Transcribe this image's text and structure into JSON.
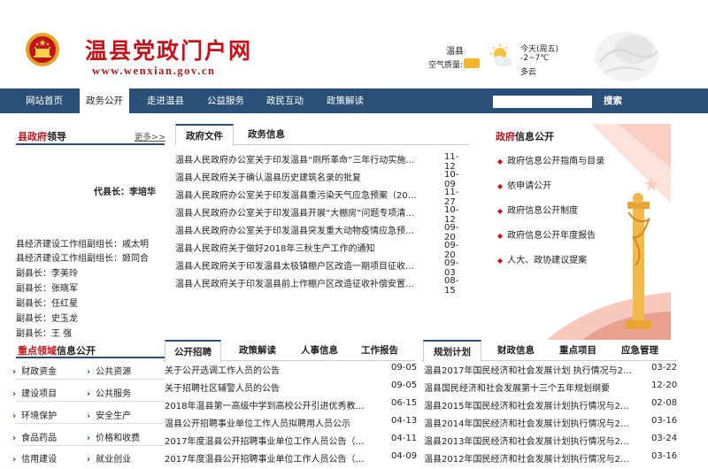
{
  "header": {
    "site_title": "温县党政门户网",
    "site_url": "www.wenxian.gov.cn",
    "weather": {
      "city": "温县",
      "air_quality_label": "空气质量:",
      "day": "今天(周五)",
      "temperature": "-2~7℃",
      "condition": "多云",
      "icon": "sun-cloud-icon"
    }
  },
  "nav": {
    "items": [
      "网站首页",
      "政务公开",
      "走进温县",
      "公益服务",
      "政民互动",
      "政策解读"
    ],
    "active_index": 1,
    "search_label": "搜索",
    "search_placeholder": ""
  },
  "leaders": {
    "title_red": "县政府",
    "title_rest": "领导",
    "more": "更多>>",
    "county_head": "代县长：李培华",
    "deputies": [
      "县经济建设工作组副组长：戚太明",
      "县经济建设工作组副组长：姬同合",
      "副县长：李美玲",
      "副县长：张晓军",
      "副县长：任红星",
      "副县长：史玉龙",
      "副县长：王 强"
    ]
  },
  "docs": {
    "tabs": [
      "政府文件",
      "政务信息"
    ],
    "rows": [
      {
        "title": "温县人民政府办公室关于印发温县“厕所革命”三年行动实施方案",
        "date": "11-12"
      },
      {
        "title": "温县人民政府关于确认温县历史建筑名录的批复",
        "date": "10-09"
      },
      {
        "title": "温县人民政府办公室关于印发温县重污染天气应急预案（2018年修订）的通知",
        "date": "11-27"
      },
      {
        "title": "温县人民政府办公室关于印发温县开展“大棚房”问题专项清理整治行动方案",
        "date": "10-12"
      },
      {
        "title": "温县人民政府办公室关于印发温县突发重大动物疫情应急预案的通知",
        "date": "09-20"
      },
      {
        "title": "温县人民政府关于做好2018年三秋生产工作的通知",
        "date": "09-20"
      },
      {
        "title": "温县人民政府关于印发温县太极镇棚户区改造一期项目征收补偿方案的通知",
        "date": "09-03"
      },
      {
        "title": "温县人民政府关于印发温县前上作棚户区改造征收补偿安置方案的通知",
        "date": "08-15"
      }
    ]
  },
  "info": {
    "title_red": "政府",
    "title_rest": "信息公开",
    "items": [
      "政府信息公开指南与目录",
      "依申请公开",
      "政府信息公开制度",
      "政府信息公开年度报告",
      "人大、政协建议提案"
    ]
  },
  "key_areas": {
    "title_red": "重点领域",
    "title_rest": "信息公开",
    "items": [
      "财政资金",
      "公共资源",
      "建设项目",
      "公共服务",
      "环境保护",
      "安全生产",
      "食品药品",
      "价格和收费",
      "信用建设",
      "就业创业"
    ]
  },
  "recruit": {
    "tabs": [
      "公开招聘",
      "政策解读",
      "人事信息",
      "工作报告"
    ],
    "rows": [
      {
        "title": "关于公开选调工作人员的公告",
        "date": "09-05"
      },
      {
        "title": "关于招聘社区辅警人员的公告",
        "date": "09-05"
      },
      {
        "title": "2018年温县第一高级中学到高校公开引进优秀教师实施方案",
        "date": "06-15"
      },
      {
        "title": "温县公开招聘事业单位工作人员拟聘用人员公示",
        "date": "04-13"
      },
      {
        "title": "2017年度温县公开招聘事业单位工作人员公告（第十号）",
        "date": "04-11"
      },
      {
        "title": "2017年度温县公开招聘事业单位工作人员公告（第十一号）",
        "date": "04-09"
      }
    ]
  },
  "plans": {
    "tabs": [
      "规划计划",
      "财政信息",
      "重点项目",
      "应急管理"
    ],
    "rows": [
      {
        "title": "温县2017年国民经济和社会发展计划 执行情况与2018年计划",
        "date": "03-22"
      },
      {
        "title": "温县国民经济和社会发展第十三个五年规划纲要",
        "date": "12-20"
      },
      {
        "title": "温县2015年国民经济和社会发展计划执行情况与2016年计划",
        "date": "02-08"
      },
      {
        "title": "温县2014年国民经济和社会发展计划执行情况与2015年计划",
        "date": "03-16"
      },
      {
        "title": "温县2013年国民经济和社会发展计划执行情况与2014年计划",
        "date": "03-24"
      },
      {
        "title": "温县2012年国民经济和社会发展计划执行情况与2013年计划",
        "date": "03-16"
      }
    ]
  }
}
